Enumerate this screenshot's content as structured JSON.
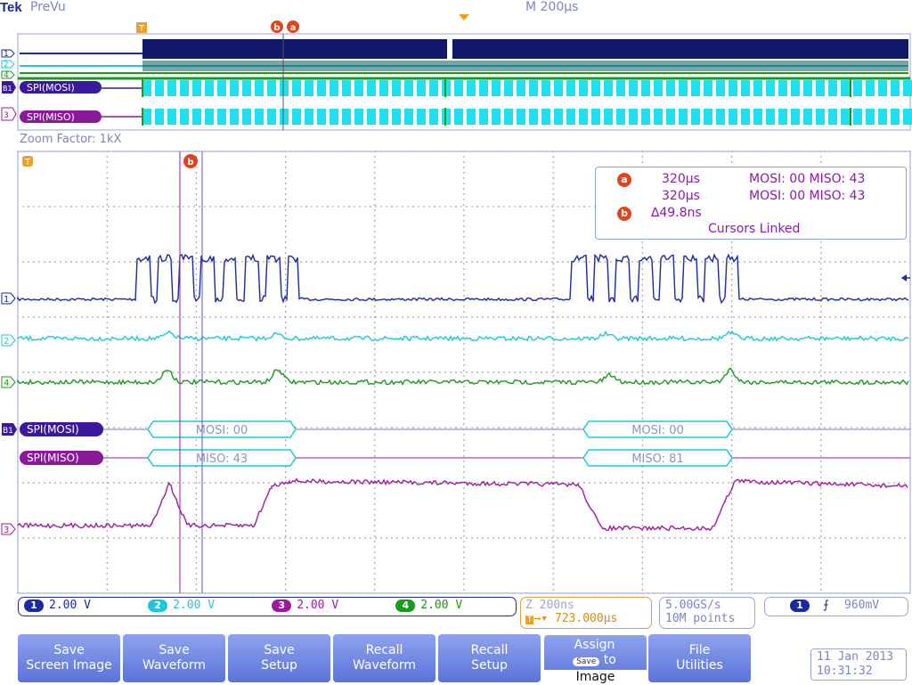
{
  "header": {
    "brand": "Tek",
    "mode": "PreVu",
    "timebase": "M 200µs"
  },
  "overview": {
    "trigger_label": "T",
    "cursor_b": "b",
    "cursor_a": "a",
    "channel_markers": [
      "1",
      "2",
      "4"
    ],
    "bus_labels": [
      {
        "marker": "B1",
        "label": "SPI(MOSI)"
      },
      {
        "marker": "3",
        "label": "SPI(MISO)"
      }
    ]
  },
  "zoom": {
    "factor_label": "Zoom Factor: 1kX",
    "trigger_label": "T",
    "cursor_label": "b"
  },
  "cursor_panel": {
    "a_marker": "a",
    "a_time": "320µs",
    "a_decode": "MOSI: 00  MISO: 43",
    "b_time": "320µs",
    "b_decode": "MOSI: 00  MISO: 43",
    "b_marker": "b",
    "delta": "∆49.8ns",
    "linked": "Cursors Linked"
  },
  "channel_markers": [
    "1",
    "2",
    "4",
    "3"
  ],
  "buses": [
    {
      "marker": "B1",
      "name": "SPI(MOSI)",
      "packets": [
        "MOSI: 00",
        "MOSI: 00"
      ]
    },
    {
      "marker": "",
      "name": "SPI(MISO)",
      "packets": [
        "MISO: 43",
        "MISO: 81"
      ]
    }
  ],
  "readouts": {
    "channels": [
      {
        "num": "1",
        "value": "2.00 V",
        "color": "#1a2aa0"
      },
      {
        "num": "2",
        "value": "2.00 V",
        "color": "#1ec8d8"
      },
      {
        "num": "3",
        "value": "2.00 V",
        "color": "#a01aa0"
      },
      {
        "num": "4",
        "value": "2.00 V",
        "color": "#1a9a1a"
      }
    ],
    "zoom_time": "Z 200ns",
    "trigger_pos": "723.000µs",
    "sample_rate": "5.00GS/s",
    "record_length": "10M points",
    "trigger_source": "1",
    "trigger_level": "960mV"
  },
  "buttons": [
    {
      "line1": "Save",
      "line2": "Screen Image"
    },
    {
      "line1": "Save",
      "line2": "Waveform"
    },
    {
      "line1": "Save",
      "line2": "Setup"
    },
    {
      "line1": "Recall",
      "line2": "Waveform"
    },
    {
      "line1": "Recall",
      "line2": "Setup"
    },
    {
      "line1": "Assign",
      "badge": "Save",
      "line2": "to",
      "line3": "Image"
    },
    {
      "line1": "File",
      "line2": "Utilities"
    }
  ],
  "datetime": {
    "date": "11 Jan  2013",
    "time": "10:31:32"
  },
  "colors": {
    "ch1": "#1a2aa0",
    "ch2": "#1ec8d8",
    "ch3": "#a01aa0",
    "ch4": "#1a9a1a",
    "accent": "#e0461e",
    "cursor_a": "#a01aa0",
    "cursor_b": "#6a4ae0"
  }
}
